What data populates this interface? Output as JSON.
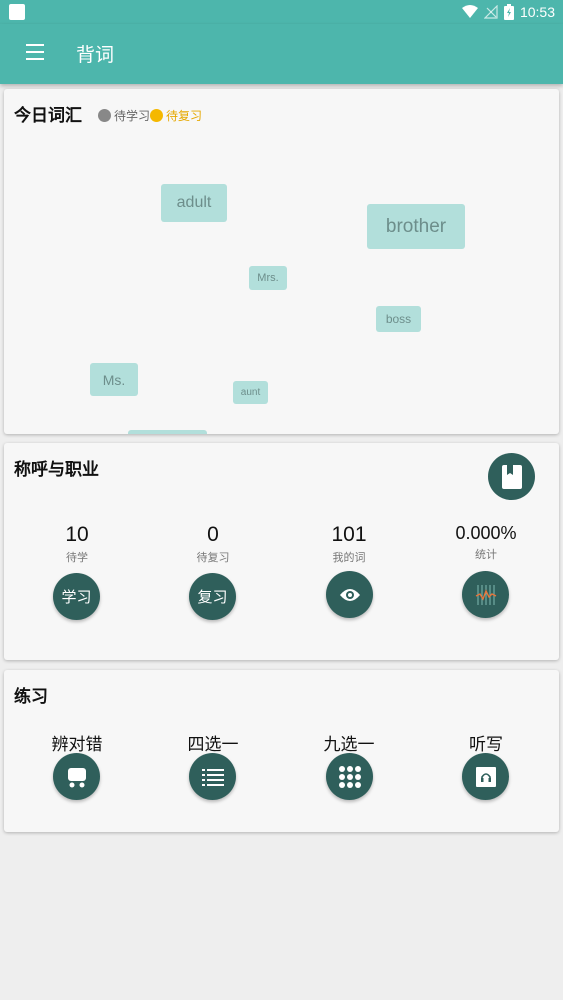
{
  "status_bar": {
    "time": "10:53"
  },
  "app_bar": {
    "title": "背词",
    "menu_icon": "hamburger-icon"
  },
  "today": {
    "title": "今日词汇",
    "legend": [
      {
        "label": "待学习",
        "color": "#888888"
      },
      {
        "label": "待复习",
        "color": "#f5b800"
      }
    ],
    "words": [
      "adult",
      "brother",
      "Mrs.",
      "boss",
      "Ms.",
      "aunt",
      ""
    ]
  },
  "category": {
    "title": "称呼与职业",
    "book_icon": "book-icon",
    "stats": [
      {
        "value": "10",
        "label": "待学",
        "button": "学习"
      },
      {
        "value": "0",
        "label": "待复习",
        "button": "复习"
      },
      {
        "value": "101",
        "label": "我的词",
        "button_icon": "eye-icon"
      },
      {
        "value": "0.000%",
        "label": "统计",
        "button_icon": "chart-icon"
      }
    ]
  },
  "practice": {
    "title": "练习",
    "items": [
      {
        "label": "辨对错",
        "icon": "cart-icon"
      },
      {
        "label": "四选一",
        "icon": "list-icon"
      },
      {
        "label": "九选一",
        "icon": "grid-icon"
      },
      {
        "label": "听写",
        "icon": "headphones-icon"
      }
    ]
  }
}
